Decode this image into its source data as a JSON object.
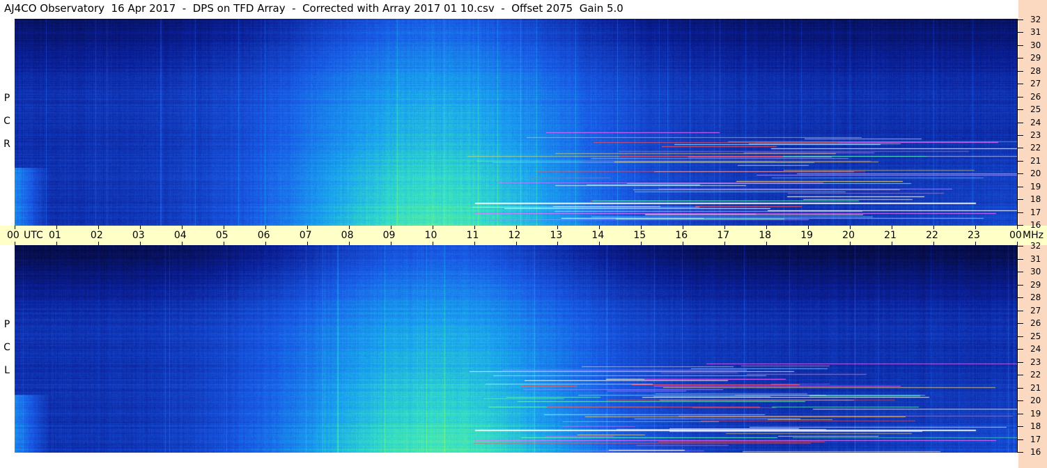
{
  "title": "AJ4CO Observatory  16 Apr 2017  -  DPS on TFD Array  -  Corrected with Array 2017 01 10.csv  -  Offset 2075  Gain 5.0",
  "panels": [
    {
      "id": "rcp",
      "label_letters": [
        "P",
        "C",
        "R"
      ]
    },
    {
      "id": "lcp",
      "label_letters": [
        "P",
        "C",
        "L"
      ]
    }
  ],
  "time_axis": {
    "labels": [
      "00",
      "UTC",
      "01",
      "02",
      "03",
      "04",
      "05",
      "06",
      "07",
      "08",
      "09",
      "10",
      "11",
      "12",
      "13",
      "14",
      "15",
      "16",
      "17",
      "18",
      "19",
      "20",
      "21",
      "22",
      "23",
      "00",
      "MHz"
    ],
    "hours": [
      "00",
      "01",
      "02",
      "03",
      "04",
      "05",
      "06",
      "07",
      "08",
      "09",
      "10",
      "11",
      "12",
      "13",
      "14",
      "15",
      "16",
      "17",
      "18",
      "19",
      "20",
      "21",
      "22",
      "23",
      "00"
    ],
    "utc_label": "UTC",
    "unit_label": "MHz"
  },
  "freq_axis": {
    "labels": [
      "32",
      "31",
      "30",
      "29",
      "28",
      "27",
      "26",
      "25",
      "24",
      "23",
      "22",
      "21",
      "20",
      "19",
      "18",
      "17",
      "16"
    ]
  },
  "colors": {
    "axis_bg": "#ffffc8",
    "right_strip": "#fbd9c0",
    "spectrogram_low": "#0a1a80",
    "spectrogram_mid": "#1f7ae0",
    "spectrogram_high": "#5ff0a0"
  }
}
